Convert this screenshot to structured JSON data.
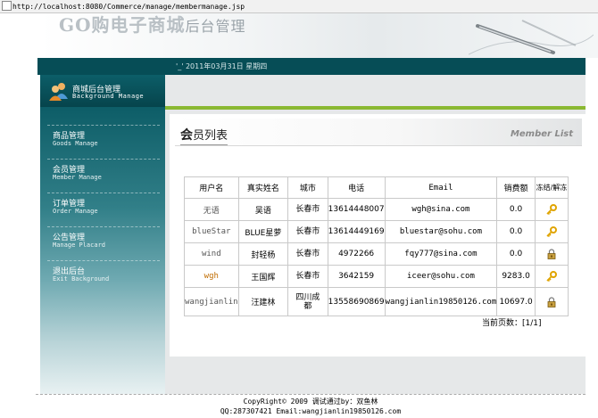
{
  "address_bar": {
    "url": "http://localhost:8080/Commerce/manage/membermanage.jsp"
  },
  "header": {
    "logo_main": "GO购电子商城",
    "logo_sub": "后台管理"
  },
  "date_bar": {
    "text": "'_' 2011年03月31日 星期四"
  },
  "sidebar": {
    "title_cn": "商城后台管理",
    "title_en": "Background Manage",
    "items": [
      {
        "cn": "商品管理",
        "en": "Goods Manage"
      },
      {
        "cn": "会员管理",
        "en": "Member Manage"
      },
      {
        "cn": "订单管理",
        "en": "Order Manage"
      },
      {
        "cn": "公告管理",
        "en": "Manage Placard"
      },
      {
        "cn": "退出后台",
        "en": "Exit Background"
      }
    ]
  },
  "panel": {
    "title_first": "会",
    "title_rest": "员列表",
    "title_en": "Member List"
  },
  "table": {
    "headers": [
      "用户名",
      "真实姓名",
      "城市",
      "电话",
      "Email",
      "销费额",
      "冻结/解冻"
    ],
    "rows": [
      {
        "username": "无语",
        "realname": "吴语",
        "city": "长春市",
        "phone": "13614448007",
        "email": "wgh@sina.com",
        "amount": "0.0",
        "icon": "key-icon",
        "user_color": "gray"
      },
      {
        "username": "blueStar",
        "realname": "BLUE星萝",
        "city": "长春市",
        "phone": "13614449169",
        "email": "bluestar@sohu.com",
        "amount": "0.0",
        "icon": "key-icon",
        "user_color": "gray"
      },
      {
        "username": "wind",
        "realname": "封轻杨",
        "city": "长春市",
        "phone": "4972266",
        "email": "fqy777@sina.com",
        "amount": "0.0",
        "icon": "lock-icon",
        "user_color": "gray"
      },
      {
        "username": "wgh",
        "realname": "王国辉",
        "city": "长春市",
        "phone": "3642159",
        "email": "iceer@sohu.com",
        "amount": "9283.0",
        "icon": "key-icon",
        "user_color": "orange"
      },
      {
        "username": "wangjianlin",
        "realname": "汪建林",
        "city": "四川成都",
        "phone": "13558690869",
        "email": "wangjianlin19850126.com",
        "amount": "10697.0",
        "icon": "lock-icon",
        "user_color": "gray"
      }
    ]
  },
  "pager": {
    "text": "当前页数：[1/1]"
  },
  "footer": {
    "line1": "CopyRight© 2009 调试通过by：双鱼林",
    "line2": "QQ:287307421 Email:wangjianlin19850126.com"
  },
  "colors": {
    "sidebar_dark": "#0c5e68",
    "accent_green": "#8ab832",
    "key_gold": "#e0a400"
  }
}
